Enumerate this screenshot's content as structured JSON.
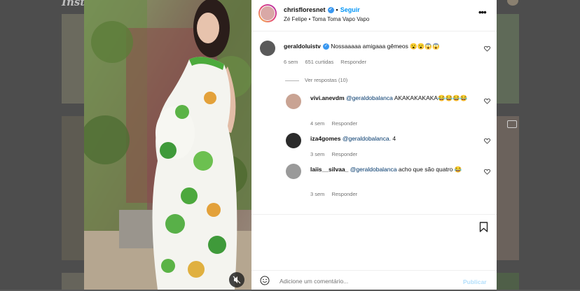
{
  "background": {
    "logo_text": "Insta"
  },
  "post": {
    "username": "chrisfloresnet",
    "separator": "•",
    "follow_label": "Seguir",
    "audio_text": "Zé Felipe • Toma Toma Vapo Vapo",
    "more_icon": "more-horizontal-icon",
    "more_glyph": "•••"
  },
  "comments": {
    "main": {
      "username": "geraldoluistv",
      "text": "Nossaaaaa amigaaa gêmeos 😮😮😱😱",
      "time": "6 sem",
      "likes": "651 curtidas",
      "reply_label": "Responder"
    },
    "view_replies": "Ver respostas (10)",
    "replies": [
      {
        "username": "vivi.anevdm",
        "mention": "@geraldobalanca",
        "text": "AKAKAKAKAKA😂😂😂😂",
        "time": "4 sem",
        "reply_label": "Responder"
      },
      {
        "username": "iza4gomes",
        "mention": "@geraldobalanca.",
        "text": "4",
        "time": "3 sem",
        "reply_label": "Responder"
      },
      {
        "username": "laiis__silvaa_",
        "mention": "@geraldobalanca",
        "text": "acho que são quatro 😂",
        "time": "3 sem",
        "reply_label": "Responder"
      }
    ]
  },
  "composer": {
    "placeholder": "Adicione um comentário...",
    "publish_label": "Publicar"
  },
  "colors": {
    "accent": "#0095f6",
    "verified": "#3897f0",
    "publish_disabled": "#b2dffc",
    "meta_text": "#737373"
  }
}
